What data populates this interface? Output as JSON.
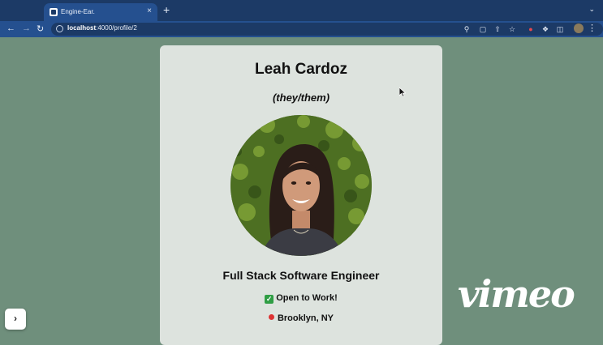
{
  "browser": {
    "tab_title": "Engine-Ear.",
    "tab_close": "×",
    "new_tab": "+",
    "url_host": "localhost",
    "url_path": ":4000/profile/2"
  },
  "profile": {
    "name": "Leah Cardoz",
    "pronouns": "(they/them)",
    "role": "Full Stack Software Engineer",
    "status": "Open to Work!",
    "status_icon": "✓",
    "location": "Brooklyn, NY"
  },
  "overlay": {
    "expand_label": "›",
    "watermark": "vimeo"
  }
}
